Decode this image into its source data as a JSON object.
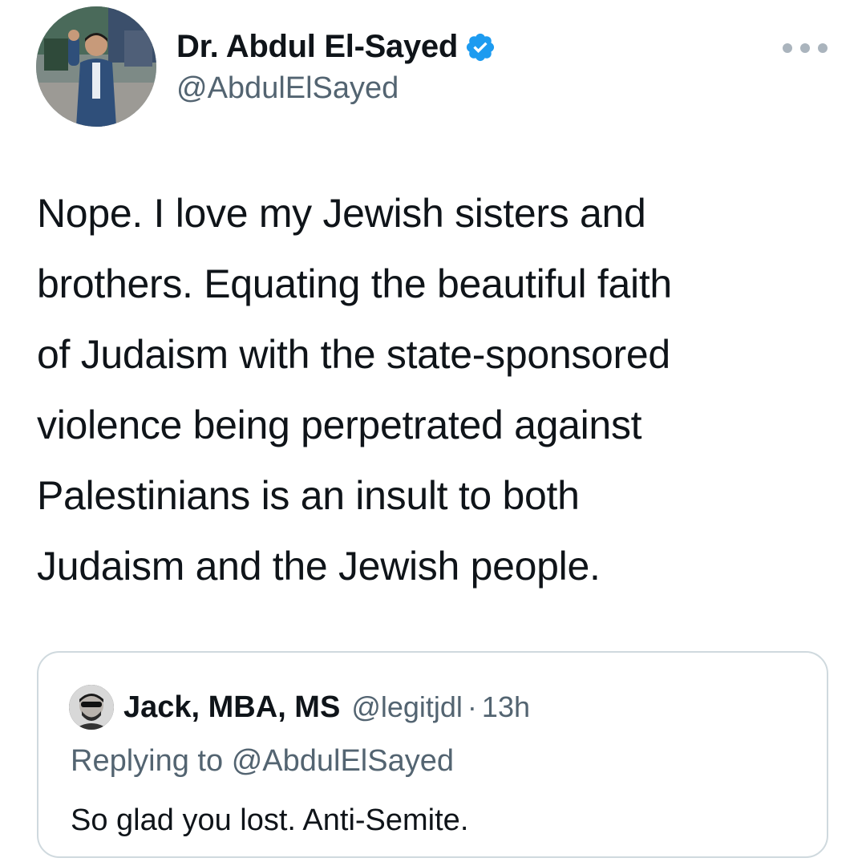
{
  "author": {
    "display_name": "Dr. Abdul El-Sayed",
    "handle": "@AbdulElSayed",
    "verified": true
  },
  "icons": {
    "verified": "verified-badge-icon",
    "more": "more-options-icon"
  },
  "tweet": {
    "lines": [
      "Nope. I love my Jewish sisters and",
      "brothers. Equating the beautiful faith",
      "of Judaism with the state-sponsored",
      "violence being perpetrated against",
      "Palestinians is an insult to both",
      "Judaism and the Jewish people."
    ]
  },
  "quoted": {
    "display_name": "Jack, MBA, MS",
    "handle": "@legitjdl",
    "separator": "·",
    "time": "13h",
    "replying_prefix": "Replying to",
    "replying_handle": "@AbdulElSayed",
    "text": "So glad you lost. Anti-Semite."
  },
  "colors": {
    "verified": "#1d9bf0",
    "text": "#0f1419",
    "secondary": "#536471",
    "border": "#cfd9de"
  }
}
